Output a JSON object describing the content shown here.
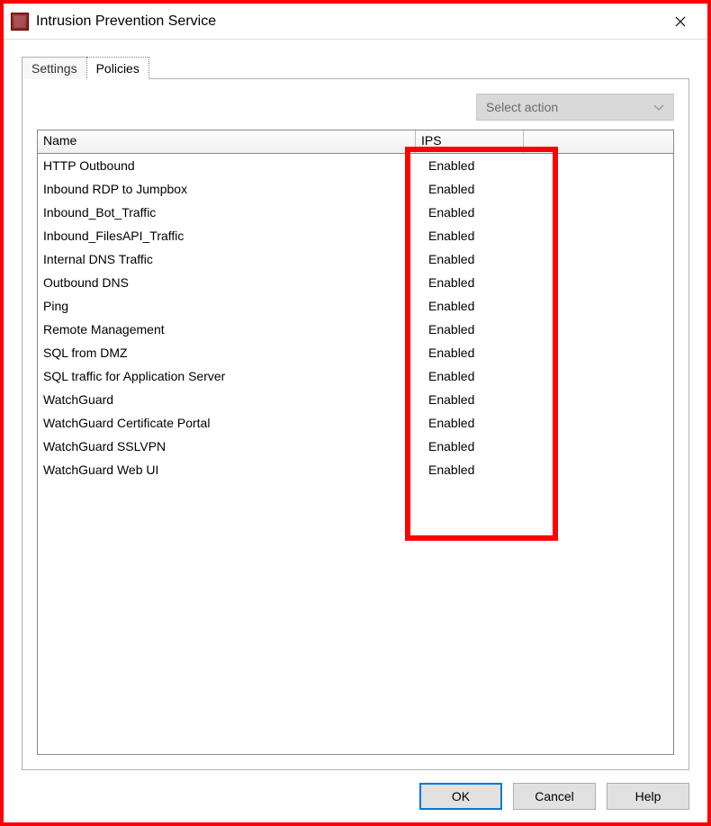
{
  "window": {
    "title": "Intrusion Prevention Service"
  },
  "tabs": {
    "settings": "Settings",
    "policies": "Policies"
  },
  "action_select": {
    "label": "Select action"
  },
  "columns": {
    "name": "Name",
    "ips": "IPS"
  },
  "rows": [
    {
      "name": "HTTP Outbound",
      "ips": "Enabled"
    },
    {
      "name": "Inbound RDP to Jumpbox",
      "ips": "Enabled"
    },
    {
      "name": "Inbound_Bot_Traffic",
      "ips": "Enabled"
    },
    {
      "name": "Inbound_FilesAPI_Traffic",
      "ips": "Enabled"
    },
    {
      "name": "Internal DNS Traffic",
      "ips": "Enabled"
    },
    {
      "name": "Outbound DNS",
      "ips": "Enabled"
    },
    {
      "name": "Ping",
      "ips": "Enabled"
    },
    {
      "name": "Remote Management",
      "ips": "Enabled"
    },
    {
      "name": "SQL from DMZ",
      "ips": "Enabled"
    },
    {
      "name": "SQL traffic for Application Server",
      "ips": "Enabled"
    },
    {
      "name": "WatchGuard",
      "ips": "Enabled"
    },
    {
      "name": "WatchGuard Certificate Portal",
      "ips": "Enabled"
    },
    {
      "name": "WatchGuard SSLVPN",
      "ips": "Enabled"
    },
    {
      "name": "WatchGuard Web UI",
      "ips": "Enabled"
    }
  ],
  "buttons": {
    "ok": "OK",
    "cancel": "Cancel",
    "help": "Help"
  }
}
